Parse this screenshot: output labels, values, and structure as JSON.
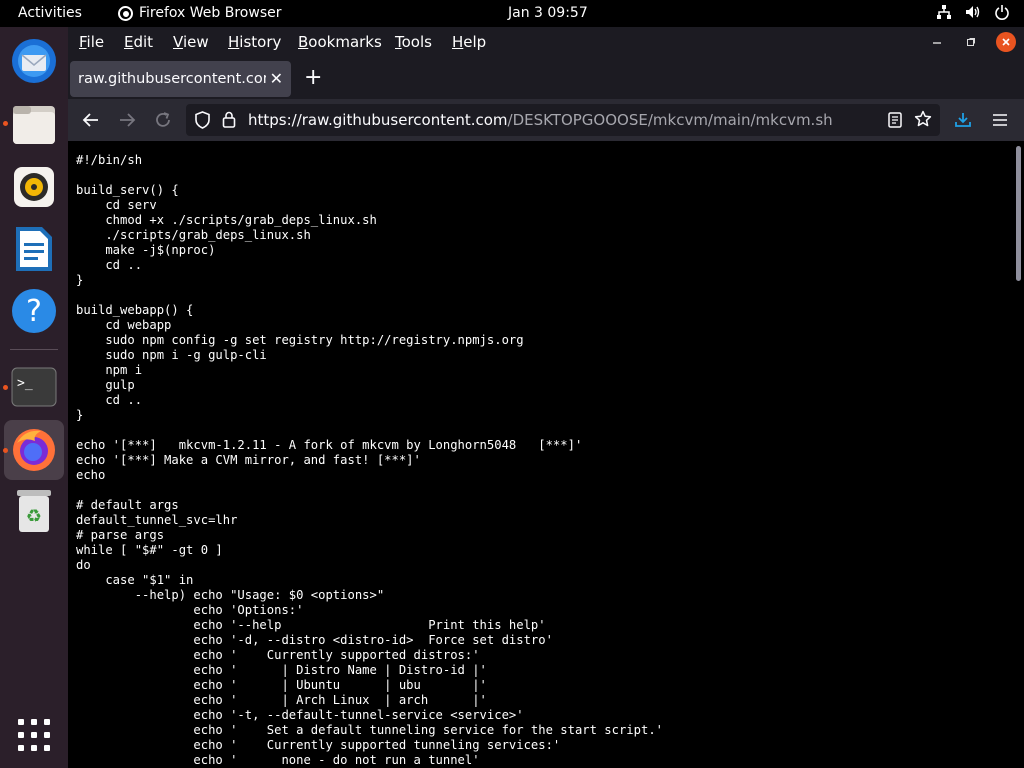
{
  "topbar": {
    "activities": "Activities",
    "app_name": "Firefox Web Browser",
    "clock": "Jan 3  09:57"
  },
  "dock": {
    "items": [
      {
        "name": "thunderbird-icon"
      },
      {
        "name": "files-icon"
      },
      {
        "name": "rhythmbox-icon"
      },
      {
        "name": "libreoffice-writer-icon"
      },
      {
        "name": "help-icon"
      },
      {
        "name": "terminal-icon"
      },
      {
        "name": "firefox-icon"
      },
      {
        "name": "trash-icon"
      },
      {
        "name": "show-apps-icon"
      }
    ]
  },
  "menubar": {
    "items": [
      "File",
      "Edit",
      "View",
      "History",
      "Bookmarks",
      "Tools",
      "Help"
    ],
    "underline": [
      "F",
      "E",
      "V",
      "H",
      "B",
      "T",
      "H"
    ]
  },
  "tab": {
    "title": "raw.githubusercontent.com/",
    "close": "✕",
    "new_tab": "+"
  },
  "urlbar": {
    "host": "https://raw.githubusercontent.com",
    "path": "/DESKTOPGOOOSE/mkcvm/main/mkcvm.sh"
  },
  "code": "#!/bin/sh\n\nbuild_serv() {\n    cd serv\n    chmod +x ./scripts/grab_deps_linux.sh\n    ./scripts/grab_deps_linux.sh\n    make -j$(nproc)\n    cd ..\n}\n\nbuild_webapp() {\n    cd webapp\n    sudo npm config -g set registry http://registry.npmjs.org\n    sudo npm i -g gulp-cli\n    npm i\n    gulp\n    cd ..\n}\n\necho '[***]   mkcvm-1.2.11 - A fork of mkcvm by Longhorn5048   [***]'\necho '[***] Make a CVM mirror, and fast! [***]'\necho\n\n# default args\ndefault_tunnel_svc=lhr\n# parse args\nwhile [ \"$#\" -gt 0 ]\ndo\n    case \"$1\" in\n        --help) echo \"Usage: $0 <options>\"\n                echo 'Options:'\n                echo '--help                    Print this help'\n                echo '-d, --distro <distro-id>  Force set distro'\n                echo '    Currently supported distros:'\n                echo '      | Distro Name | Distro-id |'\n                echo '      | Ubuntu      | ubu       |'\n                echo '      | Arch Linux  | arch      |'\n                echo '-t, --default-tunnel-service <service>'\n                echo '    Set a default tunneling service for the start script.'\n                echo '    Currently supported tunneling services:'\n                echo '      none - do not run a tunnel'"
}
